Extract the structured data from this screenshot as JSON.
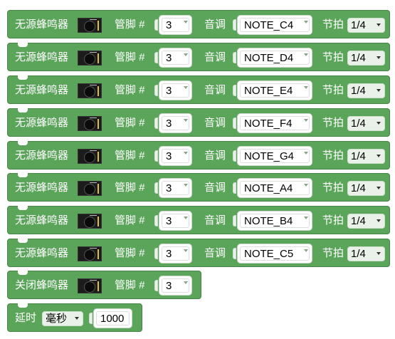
{
  "labels": {
    "passive_buzzer": "无源蜂鸣器",
    "pin": "管脚 #",
    "tone": "音调",
    "beat": "节拍",
    "close_buzzer": "关闭蜂鸣器",
    "delay": "延时"
  },
  "buzzer_blocks": [
    {
      "pin": "3",
      "note": "NOTE_C4",
      "beat": "1/4"
    },
    {
      "pin": "3",
      "note": "NOTE_D4",
      "beat": "1/4"
    },
    {
      "pin": "3",
      "note": "NOTE_E4",
      "beat": "1/4"
    },
    {
      "pin": "3",
      "note": "NOTE_F4",
      "beat": "1/4"
    },
    {
      "pin": "3",
      "note": "NOTE_G4",
      "beat": "1/4"
    },
    {
      "pin": "3",
      "note": "NOTE_A4",
      "beat": "1/4"
    },
    {
      "pin": "3",
      "note": "NOTE_B4",
      "beat": "1/4"
    },
    {
      "pin": "3",
      "note": "NOTE_C5",
      "beat": "1/4"
    }
  ],
  "close_block": {
    "pin": "3"
  },
  "delay_block": {
    "unit": "毫秒",
    "value": "1000"
  },
  "icons": [
    "buzzer-module-icon",
    "chevron-down-icon"
  ],
  "colors": {
    "block": "#5ba55b",
    "block_border": "#478447",
    "field": "#ffffff"
  }
}
